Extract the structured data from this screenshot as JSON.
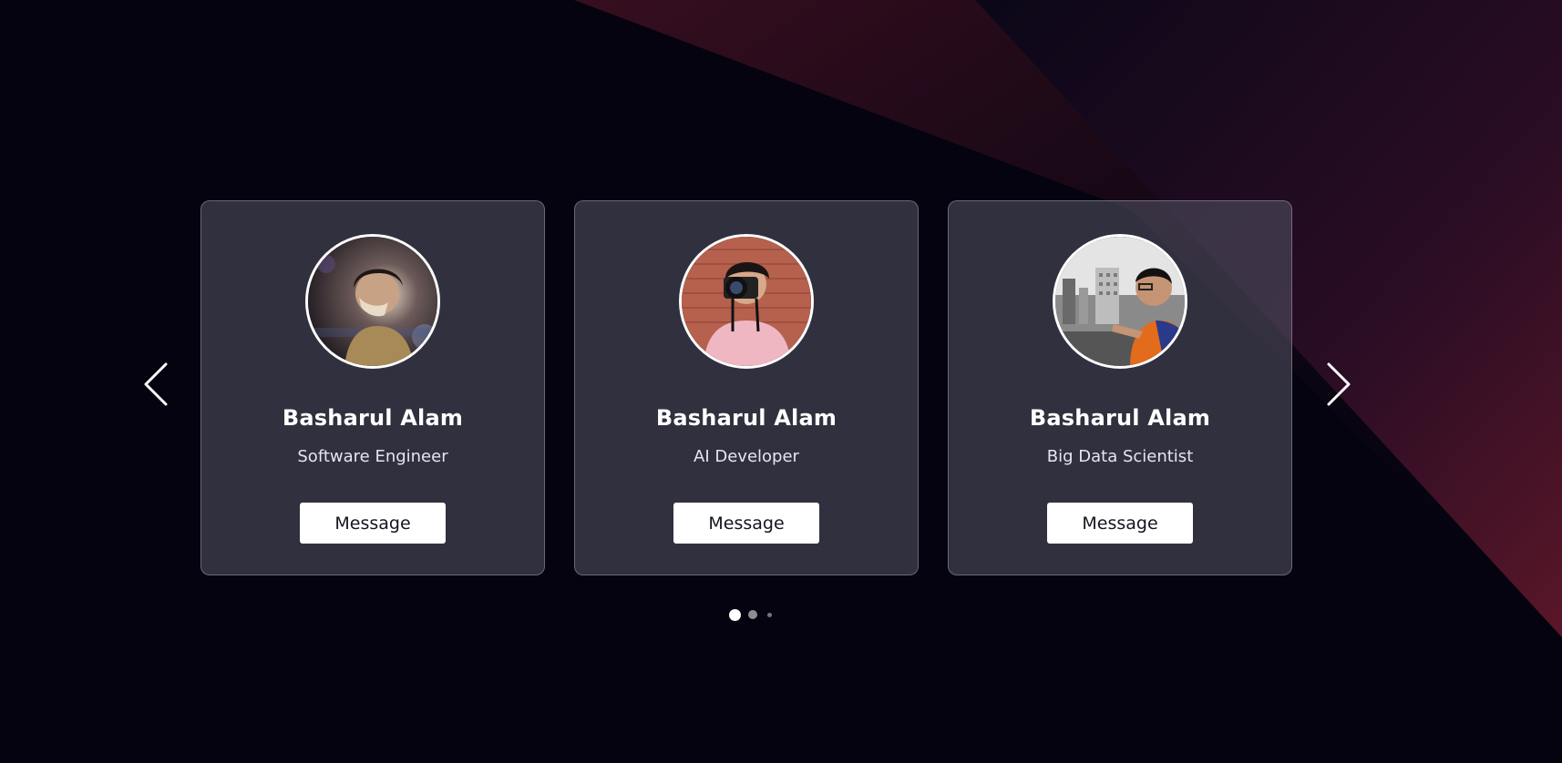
{
  "theme": {
    "background": "#04030f",
    "accent": "#5a1628",
    "card_bg": "#3a3847",
    "button_bg": "#ffffff",
    "button_text": "#16141f"
  },
  "carousel": {
    "prev_icon": "chevron-left-icon",
    "next_icon": "chevron-right-icon",
    "cards": [
      {
        "name": "Basharul Alam",
        "role": "Software Engineer",
        "button_label": "Message",
        "avatar": "profile-photo-masked-night"
      },
      {
        "name": "Basharul Alam",
        "role": "AI Developer",
        "button_label": "Message",
        "avatar": "profile-photo-camera"
      },
      {
        "name": "Basharul Alam",
        "role": "Big Data Scientist",
        "button_label": "Message",
        "avatar": "profile-photo-cityscape"
      }
    ],
    "pagination": {
      "count": 3,
      "active_index": 0
    }
  }
}
